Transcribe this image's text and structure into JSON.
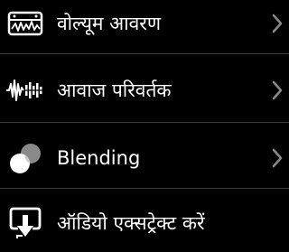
{
  "menu": {
    "items": [
      {
        "label": "वोल्यूम आवरण",
        "icon": "volume-envelope-icon"
      },
      {
        "label": "आवाज परिवर्तक",
        "icon": "waveform-icon"
      },
      {
        "label": "Blending",
        "icon": "blend-circles-icon"
      },
      {
        "label": "ऑडियो एक्सट्रेक्ट करें",
        "icon": "extract-audio-icon"
      }
    ],
    "chevron_icon": "chevron-right-icon"
  },
  "colors": {
    "background": "#000000",
    "text": "#ffffff",
    "divider": "#3a3a3a",
    "chevron": "#888888",
    "icon": "#ffffff"
  }
}
